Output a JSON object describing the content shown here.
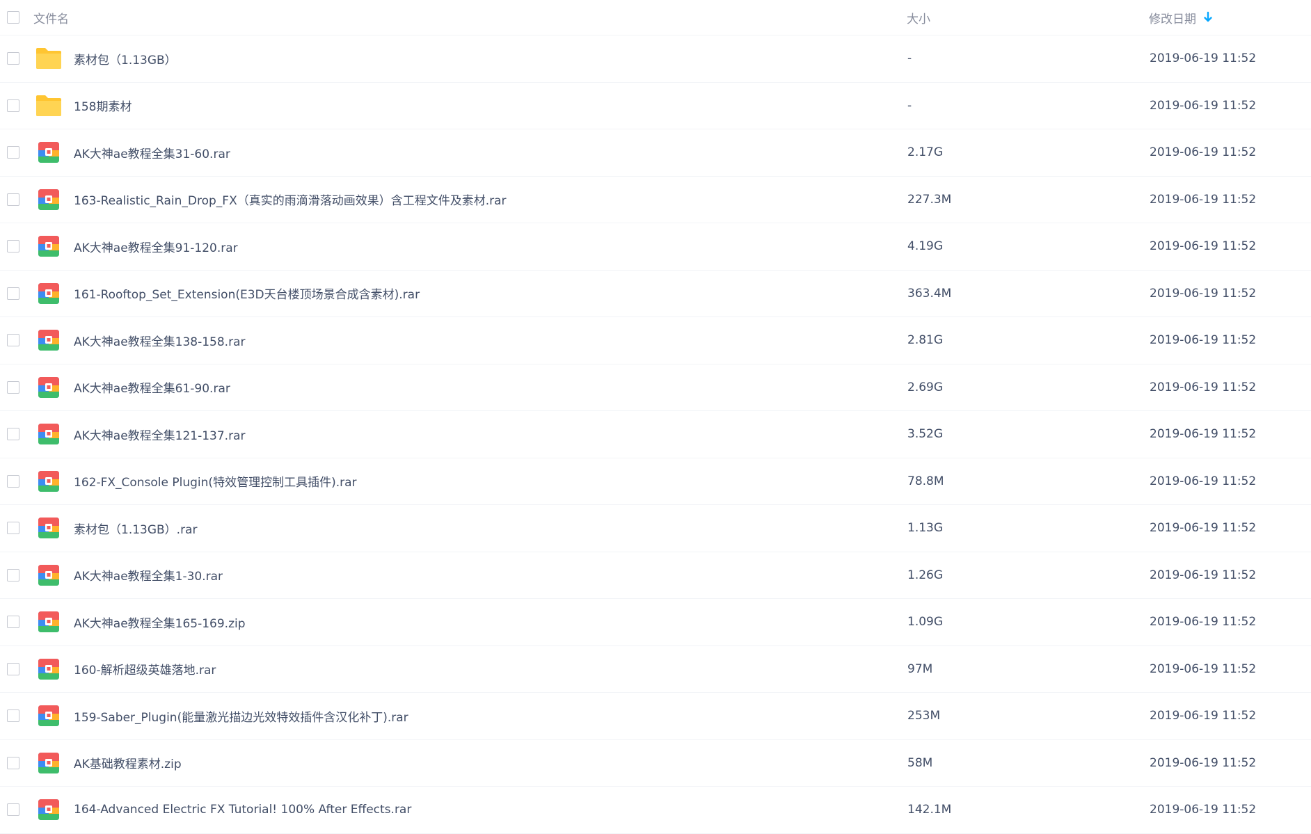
{
  "header": {
    "name_label": "文件名",
    "size_label": "大小",
    "date_label": "修改日期"
  },
  "colors": {
    "folder": "#ffd145",
    "sort_arrow": "#06a7ff",
    "archive_top": "#f25a5a",
    "archive_right": "#ffb22b",
    "archive_bottom": "#3ebd6b",
    "archive_left": "#3d8cf2"
  },
  "files": [
    {
      "icon": "folder-icon",
      "name": "素材包（1.13GB）",
      "size": "-",
      "date": "2019-06-19 11:52"
    },
    {
      "icon": "folder-icon",
      "name": "158期素材",
      "size": "-",
      "date": "2019-06-19 11:52"
    },
    {
      "icon": "archive-icon",
      "name": "AK大神ae教程全集31-60.rar",
      "size": "2.17G",
      "date": "2019-06-19 11:52"
    },
    {
      "icon": "archive-icon",
      "name": "163-Realistic_Rain_Drop_FX（真实的雨滴滑落动画效果）含工程文件及素材.rar",
      "size": "227.3M",
      "date": "2019-06-19 11:52"
    },
    {
      "icon": "archive-icon",
      "name": "AK大神ae教程全集91-120.rar",
      "size": "4.19G",
      "date": "2019-06-19 11:52"
    },
    {
      "icon": "archive-icon",
      "name": "161-Rooftop_Set_Extension(E3D天台楼顶场景合成含素材).rar",
      "size": "363.4M",
      "date": "2019-06-19 11:52"
    },
    {
      "icon": "archive-icon",
      "name": "AK大神ae教程全集138-158.rar",
      "size": "2.81G",
      "date": "2019-06-19 11:52"
    },
    {
      "icon": "archive-icon",
      "name": "AK大神ae教程全集61-90.rar",
      "size": "2.69G",
      "date": "2019-06-19 11:52"
    },
    {
      "icon": "archive-icon",
      "name": "AK大神ae教程全集121-137.rar",
      "size": "3.52G",
      "date": "2019-06-19 11:52"
    },
    {
      "icon": "archive-icon",
      "name": "162-FX_Console Plugin(特效管理控制工具插件).rar",
      "size": "78.8M",
      "date": "2019-06-19 11:52"
    },
    {
      "icon": "archive-icon",
      "name": "素材包（1.13GB）.rar",
      "size": "1.13G",
      "date": "2019-06-19 11:52"
    },
    {
      "icon": "archive-icon",
      "name": "AK大神ae教程全集1-30.rar",
      "size": "1.26G",
      "date": "2019-06-19 11:52"
    },
    {
      "icon": "archive-icon",
      "name": "AK大神ae教程全集165-169.zip",
      "size": "1.09G",
      "date": "2019-06-19 11:52"
    },
    {
      "icon": "archive-icon",
      "name": "160-解析超级英雄落地.rar",
      "size": "97M",
      "date": "2019-06-19 11:52"
    },
    {
      "icon": "archive-icon",
      "name": "159-Saber_Plugin(能量激光描边光效特效插件含汉化补丁).rar",
      "size": "253M",
      "date": "2019-06-19 11:52"
    },
    {
      "icon": "archive-icon",
      "name": "AK基础教程素材.zip",
      "size": "58M",
      "date": "2019-06-19 11:52"
    },
    {
      "icon": "archive-icon",
      "name": "164-Advanced Electric FX Tutorial! 100% After Effects.rar",
      "size": "142.1M",
      "date": "2019-06-19 11:52"
    }
  ]
}
